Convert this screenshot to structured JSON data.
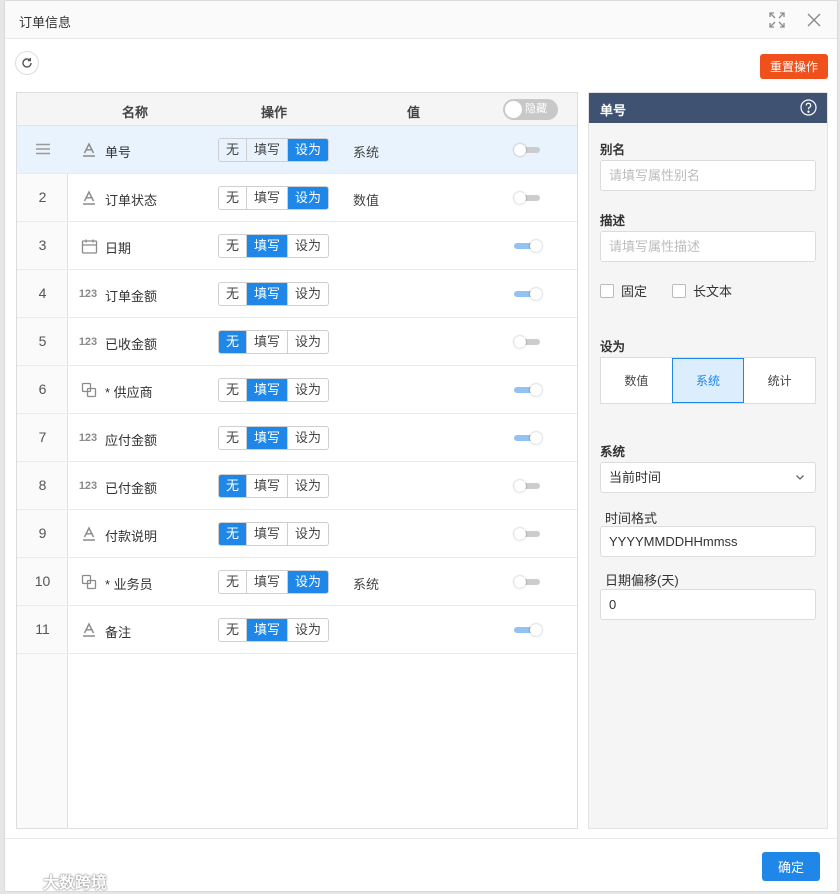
{
  "window": {
    "title": "订单信息"
  },
  "toolbar": {
    "reset_label": "重置操作"
  },
  "table": {
    "headers": {
      "name": "名称",
      "action": "操作",
      "value": "值",
      "hide_toggle": "隐藏"
    },
    "rows": [
      {
        "index": "",
        "type_icon": "text-icon",
        "name": "单号",
        "action": "设为",
        "value": "系统",
        "visible": false,
        "selected": true
      },
      {
        "index": "2",
        "type_icon": "text-icon",
        "name": "订单状态",
        "action": "设为",
        "value": "数值",
        "visible": false
      },
      {
        "index": "3",
        "type_icon": "calendar-icon",
        "name": "日期",
        "action": "填写",
        "value": "",
        "visible": true
      },
      {
        "index": "4",
        "type_icon": "number-icon",
        "name": "订单金额",
        "action": "填写",
        "value": "",
        "visible": true
      },
      {
        "index": "5",
        "type_icon": "number-icon",
        "name": "已收金额",
        "action": "无",
        "value": "",
        "visible": false
      },
      {
        "index": "6",
        "type_icon": "link-icon",
        "name": "* 供应商",
        "action": "填写",
        "value": "",
        "visible": true
      },
      {
        "index": "7",
        "type_icon": "number-icon",
        "name": "应付金额",
        "action": "填写",
        "value": "",
        "visible": true
      },
      {
        "index": "8",
        "type_icon": "number-icon",
        "name": "已付金额",
        "action": "无",
        "value": "",
        "visible": false
      },
      {
        "index": "9",
        "type_icon": "text-icon",
        "name": "付款说明",
        "action": "无",
        "value": "",
        "visible": false
      },
      {
        "index": "10",
        "type_icon": "link-icon",
        "name": "* 业务员",
        "action": "设为",
        "value": "系统",
        "visible": false
      },
      {
        "index": "11",
        "type_icon": "text-icon",
        "name": "备注",
        "action": "填写",
        "value": "",
        "visible": true
      }
    ],
    "action_options": [
      "无",
      "填写",
      "设为"
    ],
    "number_icon_text": "123"
  },
  "panel": {
    "title": "单号",
    "alias_label": "别名",
    "alias_placeholder": "请填写属性别名",
    "desc_label": "描述",
    "desc_placeholder": "请填写属性描述",
    "fixed_label": "固定",
    "longtext_label": "长文本",
    "set_label": "设为",
    "set_options": [
      "数值",
      "系统",
      "统计"
    ],
    "set_selected": "系统",
    "system_label": "系统",
    "system_value": "当前时间",
    "time_format_label": "时间格式",
    "time_format_value": "YYYYMMDDHHmmss",
    "date_offset_label": "日期偏移(天)",
    "date_offset_value": "0"
  },
  "footer": {
    "ok_label": "确定"
  },
  "watermark": "大数跨境",
  "colors": {
    "primary": "#1f87e8",
    "reset": "#f0511c",
    "panel_header": "#3f5272"
  }
}
